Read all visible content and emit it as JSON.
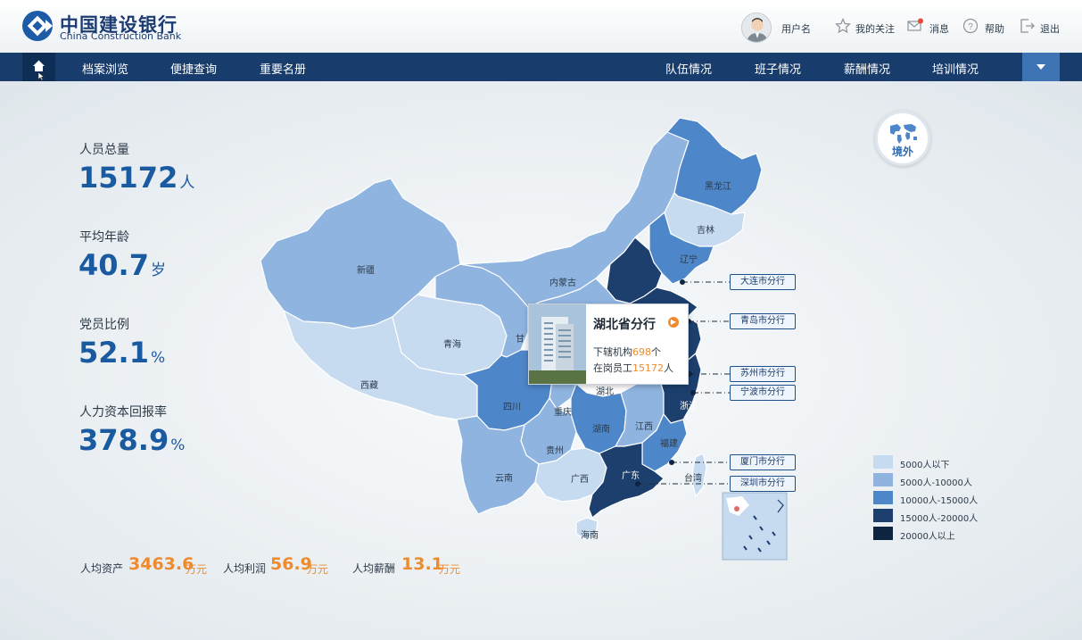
{
  "header": {
    "brand_cn": "中国建设银行",
    "brand_en": "China Construction Bank",
    "username": "用户名",
    "favorites": "我的关注",
    "messages": "消息",
    "help": "帮助",
    "logout": "退出"
  },
  "nav": {
    "left": [
      "档案浏览",
      "便捷查询",
      "重要名册"
    ],
    "right": [
      "队伍情况",
      "班子情况",
      "薪酬情况",
      "培训情况"
    ]
  },
  "stats": [
    {
      "label": "人员总量",
      "value": "15172",
      "unit": "人"
    },
    {
      "label": "平均年龄",
      "value": "40.7",
      "unit": "岁"
    },
    {
      "label": "党员比例",
      "value": "52.1",
      "unit": "%"
    },
    {
      "label": "人力资本回报率",
      "value": "378.9",
      "unit": "%"
    }
  ],
  "averages": [
    {
      "label": "人均资产",
      "value": "3463.6",
      "unit": "万元"
    },
    {
      "label": "人均利润",
      "value": "56.9",
      "unit": "万元"
    },
    {
      "label": "人均薪酬",
      "value": "13.1",
      "unit": "万元"
    }
  ],
  "overseas": {
    "label": "境外"
  },
  "popup": {
    "title": "湖北省分行",
    "line1_prefix": "下辖机构",
    "institutions": "698",
    "line1_suffix": "个",
    "line2_prefix": "在岗员工",
    "employees": "15172",
    "line2_suffix": "人"
  },
  "branches": [
    "大连市分行",
    "青岛市分行",
    "苏州市分行",
    "宁波市分行",
    "厦门市分行",
    "深圳市分行"
  ],
  "provinces": {
    "heilongjiang": "黑龙江",
    "jilin": "吉林",
    "liaoning": "辽宁",
    "neimenggu": "内蒙古",
    "xinjiang": "新疆",
    "qinghai": "青海",
    "xizang": "西藏",
    "gansu": "甘",
    "sichuan": "四川",
    "chongqing": "重庆",
    "hubei": "湖北",
    "hunan": "湖南",
    "jiangxi": "江西",
    "zhejiang": "浙江",
    "fujian": "福建",
    "guizhou": "贵州",
    "yunnan": "云南",
    "guangxi": "广西",
    "guangdong": "广东",
    "taiwan": "台湾",
    "hainan": "海南"
  },
  "legend": [
    {
      "label": "5000人以下",
      "color": "#c6daf0"
    },
    {
      "label": "5000人-10000人",
      "color": "#8fb4e0"
    },
    {
      "label": "10000人-15000人",
      "color": "#4d86c9"
    },
    {
      "label": "15000人-20000人",
      "color": "#1c3f6e"
    },
    {
      "label": "20000人以上",
      "color": "#0e2542"
    }
  ],
  "colors": {
    "navy": "#183c6b",
    "accent_orange": "#ee8b2d",
    "stat_blue": "#1a5aa0"
  }
}
